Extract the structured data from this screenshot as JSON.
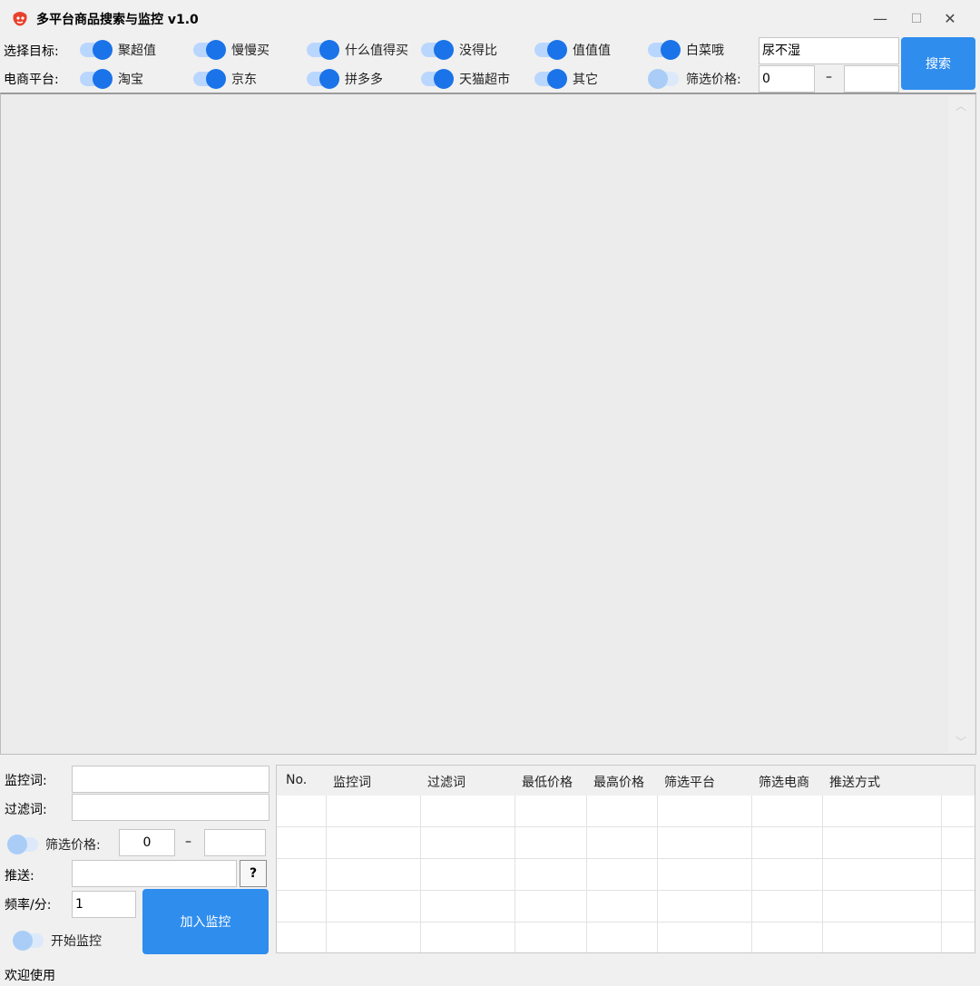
{
  "window": {
    "title": "多平台商品搜索与监控 v1.0",
    "minimize": "—",
    "maximize": "☐",
    "close": "✕"
  },
  "search": {
    "target_label": "选择目标:",
    "targets": [
      {
        "label": "聚超值",
        "on": true
      },
      {
        "label": "慢慢买",
        "on": true
      },
      {
        "label": "什么值得买",
        "on": true
      },
      {
        "label": "没得比",
        "on": true
      },
      {
        "label": "值值值",
        "on": true
      },
      {
        "label": "白菜哦",
        "on": true
      }
    ],
    "platform_label": "电商平台:",
    "platforms": [
      {
        "label": "淘宝",
        "on": true
      },
      {
        "label": "京东",
        "on": true
      },
      {
        "label": "拼多多",
        "on": true
      },
      {
        "label": "天猫超市",
        "on": true
      },
      {
        "label": "其它",
        "on": true
      }
    ],
    "price_filter_label": "筛选价格:",
    "price_filter_on": false,
    "price_min": "0",
    "price_dash": "–",
    "price_max": "",
    "keyword": "尿不湿",
    "search_button": "搜索"
  },
  "monitor": {
    "keyword_label": "监控词:",
    "keyword_value": "",
    "filter_label": "过滤词:",
    "filter_value": "",
    "price_filter_label": "筛选价格:",
    "price_filter_on": false,
    "price_min": "0",
    "price_dash": "–",
    "price_max": "",
    "push_label": "推送:",
    "push_value": "",
    "help_button": "?",
    "freq_label": "频率/分:",
    "freq_value": "1",
    "add_button": "加入监控",
    "start_label": "开始监控",
    "start_on": false
  },
  "table": {
    "columns": [
      "No.",
      "监控词",
      "过滤词",
      "最低价格",
      "最高价格",
      "筛选平台",
      "筛选电商",
      "推送方式"
    ],
    "rows": []
  },
  "status": {
    "text": "欢迎使用"
  },
  "colors": {
    "accent": "#1a73e8",
    "button": "#2f8dee"
  }
}
